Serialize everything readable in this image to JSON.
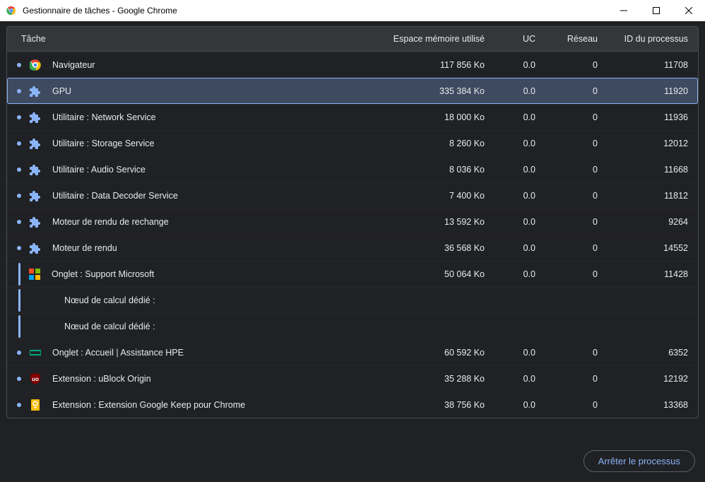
{
  "window": {
    "title": "Gestionnaire de tâches - Google Chrome"
  },
  "columns": {
    "task": "Tâche",
    "memory": "Espace mémoire utilisé",
    "cpu": "UC",
    "network": "Réseau",
    "pid": "ID du processus"
  },
  "rows": [
    {
      "icon": "chrome",
      "name": "Navigateur",
      "mem": "117 856 Ko",
      "uc": "0.0",
      "net": "0",
      "pid": "11708",
      "bullet": true,
      "selected": false
    },
    {
      "icon": "puzzle",
      "name": "GPU",
      "mem": "335 384 Ko",
      "uc": "0.0",
      "net": "0",
      "pid": "11920",
      "bullet": true,
      "selected": true
    },
    {
      "icon": "puzzle",
      "name": "Utilitaire : Network Service",
      "mem": "18 000 Ko",
      "uc": "0.0",
      "net": "0",
      "pid": "11936",
      "bullet": true
    },
    {
      "icon": "puzzle",
      "name": "Utilitaire : Storage Service",
      "mem": "8 260 Ko",
      "uc": "0.0",
      "net": "0",
      "pid": "12012",
      "bullet": true
    },
    {
      "icon": "puzzle",
      "name": "Utilitaire : Audio Service",
      "mem": "8 036 Ko",
      "uc": "0.0",
      "net": "0",
      "pid": "11668",
      "bullet": true
    },
    {
      "icon": "puzzle",
      "name": "Utilitaire : Data Decoder Service",
      "mem": "7 400 Ko",
      "uc": "0.0",
      "net": "0",
      "pid": "11812",
      "bullet": true
    },
    {
      "icon": "puzzle",
      "name": "Moteur de rendu de rechange",
      "mem": "13 592 Ko",
      "uc": "0.0",
      "net": "0",
      "pid": "9264",
      "bullet": true
    },
    {
      "icon": "puzzle",
      "name": "Moteur de rendu",
      "mem": "36 568 Ko",
      "uc": "0.0",
      "net": "0",
      "pid": "14552",
      "bullet": true
    },
    {
      "icon": "ms",
      "name": "Onglet : Support Microsoft",
      "mem": "50 064 Ko",
      "uc": "0.0",
      "net": "0",
      "pid": "11428",
      "tree": true
    },
    {
      "icon": "none",
      "name": "Nœud de calcul dédié :",
      "mem": "",
      "uc": "",
      "net": "",
      "pid": "",
      "tree": true,
      "indent": true
    },
    {
      "icon": "none",
      "name": "Nœud de calcul dédié :",
      "mem": "",
      "uc": "",
      "net": "",
      "pid": "",
      "tree": true,
      "indent": true
    },
    {
      "icon": "hpe",
      "name": "Onglet : Accueil | Assistance HPE",
      "mem": "60 592 Ko",
      "uc": "0.0",
      "net": "0",
      "pid": "6352",
      "bullet": true
    },
    {
      "icon": "ublock",
      "name": "Extension : uBlock Origin",
      "mem": "35 288 Ko",
      "uc": "0.0",
      "net": "0",
      "pid": "12192",
      "bullet": true
    },
    {
      "icon": "keep",
      "name": "Extension : Extension Google Keep pour Chrome",
      "mem": "38 756 Ko",
      "uc": "0.0",
      "net": "0",
      "pid": "13368",
      "bullet": true
    }
  ],
  "footer": {
    "end_process": "Arrêter le processus"
  }
}
